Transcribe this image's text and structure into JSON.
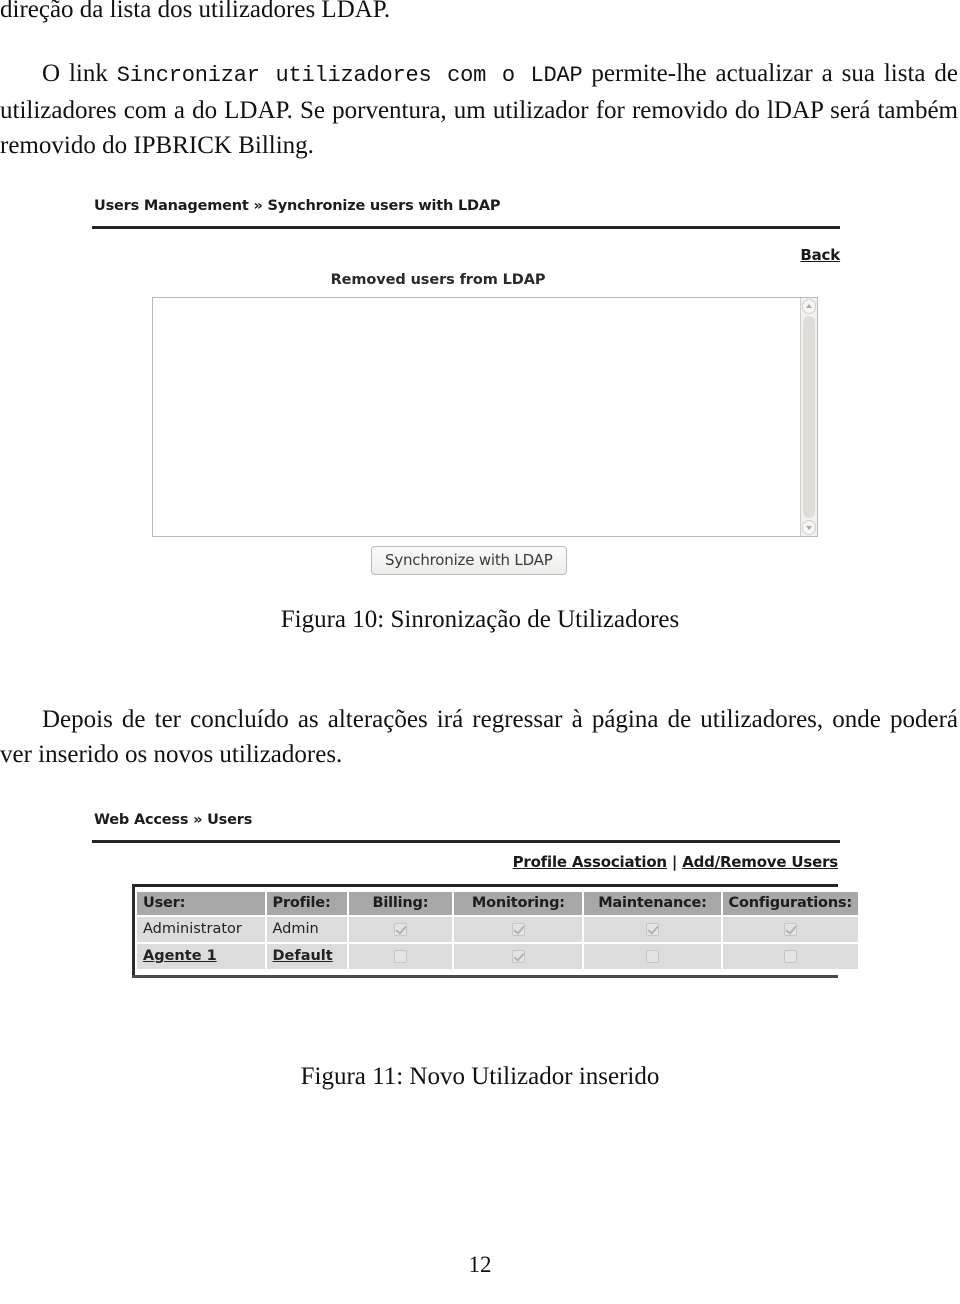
{
  "document": {
    "page_number": "12",
    "paragraphs": {
      "top": "direção da lista dos utilizadores LDAP.",
      "intro_before_code": "O link ",
      "intro_code": "Sincronizar utilizadores com o LDAP",
      "intro_after_code": " permite-lhe actualizar a sua lista de utilizadores com a do LDAP. Se porventura, um utilizador for removido do lDAP será também removido do IPBRICK Billing.",
      "after_figure10": "Depois de ter concluído as alterações irá regressar à página de utilizadores, onde poderá ver inserido os novos utilizadores."
    },
    "captions": {
      "figure_10": "Figura 10: Sinronização de Utilizadores",
      "figure_11": "Figura 11: Novo Utilizador inserido"
    }
  },
  "screenshot_sync": {
    "breadcrumb": "Users Management » Synchronize users with LDAP",
    "back_link": "Back",
    "listbox_label": "Removed users from LDAP",
    "listbox_value": "",
    "scrollbar": {
      "up_arrow": "scroll-up-icon",
      "down_arrow": "scroll-down-icon"
    },
    "submit_button": "Synchronize with LDAP"
  },
  "screenshot_users": {
    "breadcrumb": "Web Access » Users",
    "links": {
      "profile_association": "Profile Association",
      "separator": "|",
      "add_remove_users": "Add/Remove Users"
    },
    "table": {
      "headers": [
        "User:",
        "Profile:",
        "Billing:",
        "Monitoring:",
        "Maintenance:",
        "Configurations:"
      ],
      "rows": [
        {
          "user": "Administrator",
          "profile": "Admin",
          "is_link": false,
          "billing": true,
          "monitoring": true,
          "maintenance": true,
          "configurations": true
        },
        {
          "user": "Agente 1",
          "profile": "Default",
          "is_link": true,
          "billing": false,
          "monitoring": true,
          "maintenance": false,
          "configurations": false
        }
      ]
    }
  },
  "colors": {
    "page_background": "#ffffff",
    "text": "#111111",
    "rule": "#242424",
    "table_header_bg": "#a8a8a8",
    "table_cell_bg": "#dcdcdc",
    "listbox_border": "#b9b9b9",
    "scrollbar_track": "#f2f1ef",
    "scrollbar_thumb": "#dedcd7"
  }
}
